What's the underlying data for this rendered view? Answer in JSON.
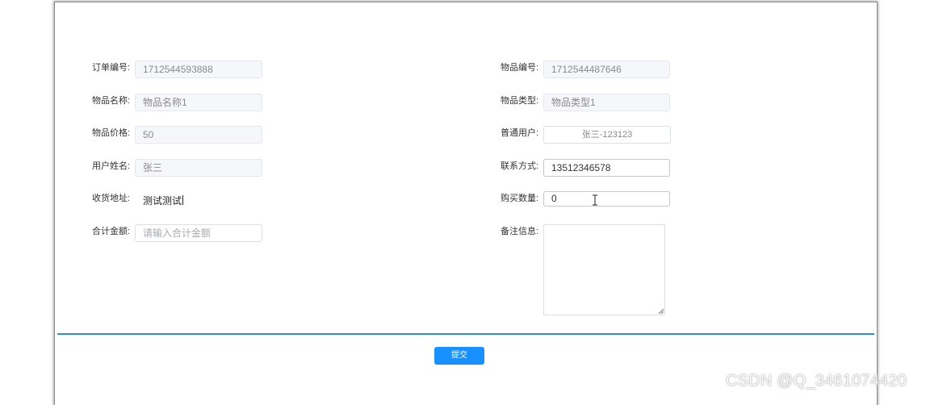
{
  "form": {
    "order_no": {
      "label": "订单编号:",
      "value": "1712544593888"
    },
    "item_no": {
      "label": "物品编号:",
      "value": "1712544487646"
    },
    "item_name": {
      "label": "物品名称:",
      "value": "物品名称1"
    },
    "item_type": {
      "label": "物品类型:",
      "value": "物品类型1"
    },
    "item_price": {
      "label": "物品价格:",
      "value": "50"
    },
    "regular_user": {
      "label": "普通用户:",
      "value": "张三-123123"
    },
    "user_name": {
      "label": "用户姓名:",
      "value": "张三"
    },
    "contact": {
      "label": "联系方式:",
      "value": "13512346578"
    },
    "address": {
      "label": "收货地址:",
      "value": "测试测试"
    },
    "quantity": {
      "label": "购买数量:",
      "value": "0"
    },
    "total": {
      "label": "合计金额:",
      "placeholder": "请输入合计金额"
    },
    "remarks": {
      "label": "备注信息:",
      "value": ""
    }
  },
  "actions": {
    "submit_label": "提交"
  },
  "watermark": "CSDN @Q_3461074420",
  "colors": {
    "accent": "#1890ff",
    "divider": "#2d8ce8"
  }
}
